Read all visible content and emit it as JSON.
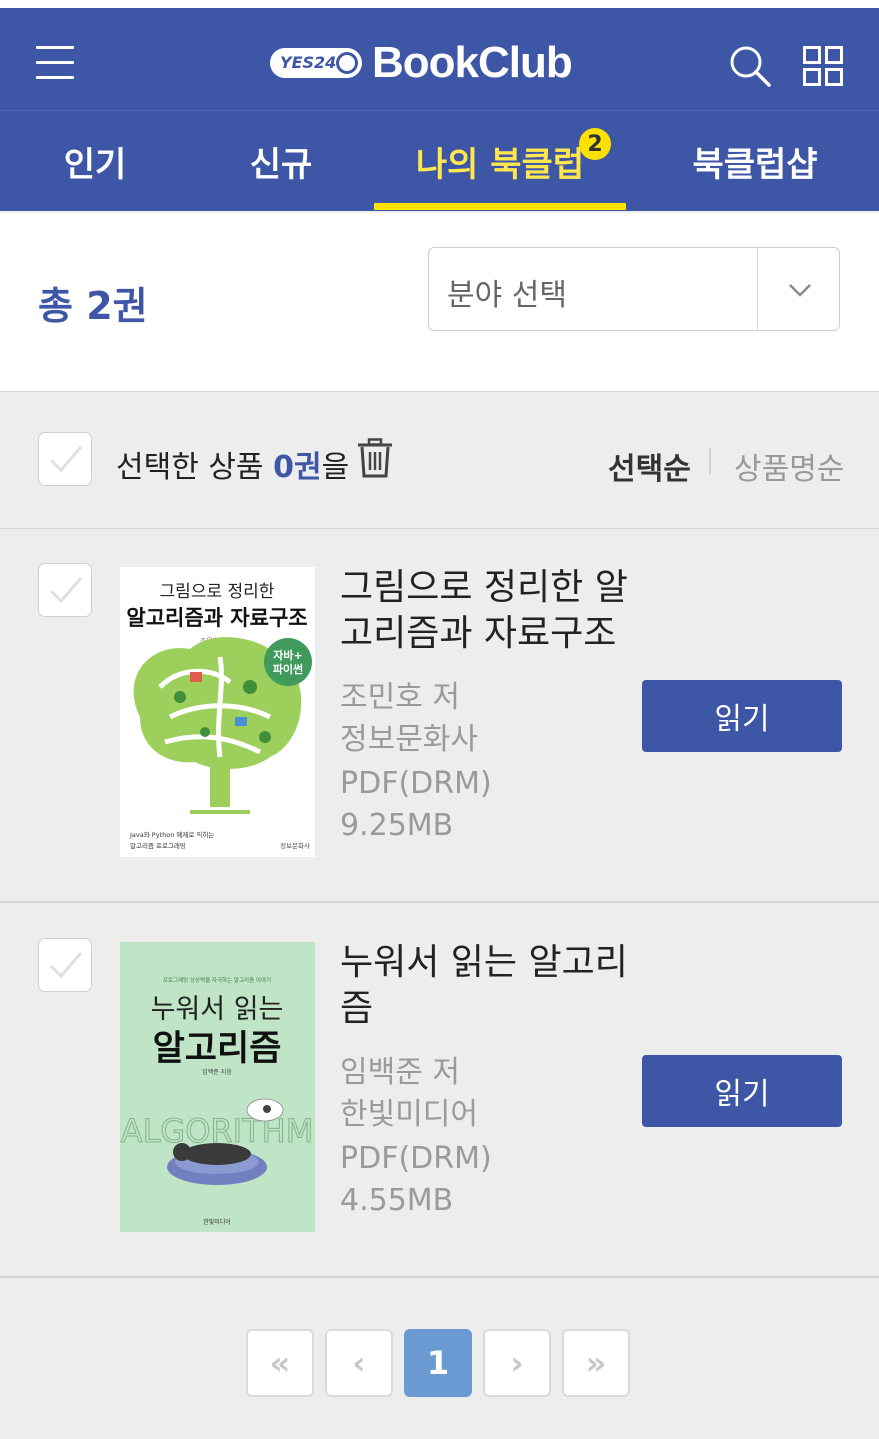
{
  "header": {
    "logo_small": "YES24",
    "logo_brand": "BookClub"
  },
  "tabs": [
    {
      "label": "인기",
      "active": false
    },
    {
      "label": "신규",
      "active": false
    },
    {
      "label": "나의 북클럽",
      "active": true,
      "badge": "2"
    },
    {
      "label": "북클럽샵",
      "active": false
    }
  ],
  "summary": {
    "total": "총 2권",
    "category_select": "분야 선택"
  },
  "toolbar": {
    "prefix": "선택한 상품 ",
    "count": "0권",
    "suffix": "을",
    "sort_selected": "선택순",
    "sort_other": "상품명순"
  },
  "books": [
    {
      "title": "그림으로 정리한 알고리즘과 자료구조",
      "author": "조민호 저",
      "publisher": "정보문화사",
      "format": "PDF(DRM)",
      "size": "9.25MB",
      "read_label": "읽기",
      "cover": {
        "top": "그림으로 정리한",
        "main": "알고리즘과 자료구조",
        "author": "조민호 지음",
        "badge1": "자바+",
        "badge2": "파이썬",
        "foot1": "Java와 Python 예제로 익히는",
        "foot2": "알고리즘 프로그래밍",
        "publisher": "정보문화사"
      }
    },
    {
      "title": "누워서 읽는 알고리즘",
      "author": "임백준 저",
      "publisher": "한빛미디어",
      "format": "PDF(DRM)",
      "size": "4.55MB",
      "read_label": "읽기",
      "cover": {
        "tag": "프로그래밍 상상력을 자극하는 알고리즘 이야기",
        "line1": "누워서 읽는",
        "main": "알고리즘",
        "author": "임백준 지음",
        "art": "ALGORITHM",
        "publisher": "한빛미디어"
      }
    }
  ],
  "pagination": {
    "first": "«",
    "prev": "‹",
    "current": "1",
    "next": "›",
    "last": "»"
  },
  "colors": {
    "primary": "#3e56a6",
    "accent": "#ffe100",
    "page_active": "#6b9ad3"
  },
  "icons": [
    "menu-icon",
    "search-icon",
    "grid-icon",
    "chevron-down-icon",
    "check-icon",
    "trash-icon"
  ]
}
